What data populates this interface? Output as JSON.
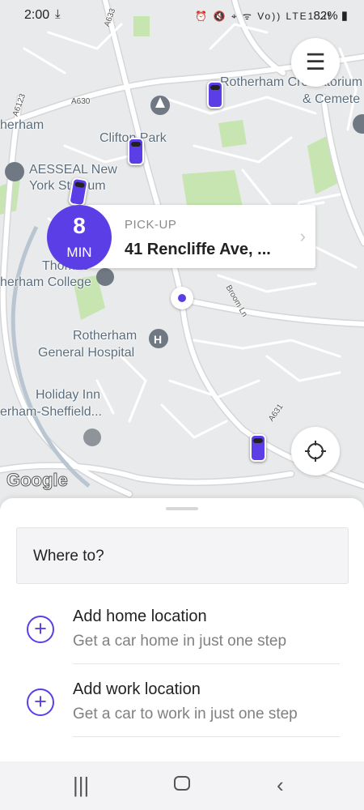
{
  "status_bar": {
    "time": "2:00",
    "download_icon": "download-arrow-icon",
    "battery": "82%",
    "indicators": "⏰ 🔇 ⌖ ᯤ Vo)) LTE1 .ıl"
  },
  "map": {
    "labels": {
      "crematorium_1": "Rotherham Crematorium",
      "crematorium_2": "& Cemete",
      "clifton_park": "Clifton Park",
      "rotherham_partial": "herham",
      "aesseal_1": "AESSEAL New",
      "aesseal_2": "York Stadium",
      "college_1": "Thomas",
      "college_2": "herham College",
      "broom_ln": "Broom Ln",
      "hospital_1": "Rotherham",
      "hospital_2": "General Hospital",
      "holiday_1": "Holiday Inn",
      "holiday_2": "erham-Sheffield...",
      "a630": "A630",
      "a6123": "A6123",
      "a631": "A631",
      "a633": "A633",
      "google": "Google"
    }
  },
  "eta": {
    "number": "8",
    "unit": "MIN"
  },
  "pickup": {
    "label": "PICK-UP",
    "address": "41 Rencliffe Ave, ..."
  },
  "sheet": {
    "where_to": "Where to?",
    "home": {
      "title": "Add home location",
      "subtitle": "Get a car home in just one step"
    },
    "work": {
      "title": "Add work location",
      "subtitle": "Get a car to work in just one step"
    }
  },
  "icons": {
    "menu": "hamburger-menu-icon",
    "locate": "crosshair-locate-icon",
    "plus": "plus-circle-icon",
    "back": "back-chevron-icon",
    "home": "home-nav-icon",
    "recents": "recents-icon"
  },
  "colors": {
    "accent": "#5b3ee6",
    "map_bg": "#e9eaeb",
    "park": "#c6e5b0"
  }
}
